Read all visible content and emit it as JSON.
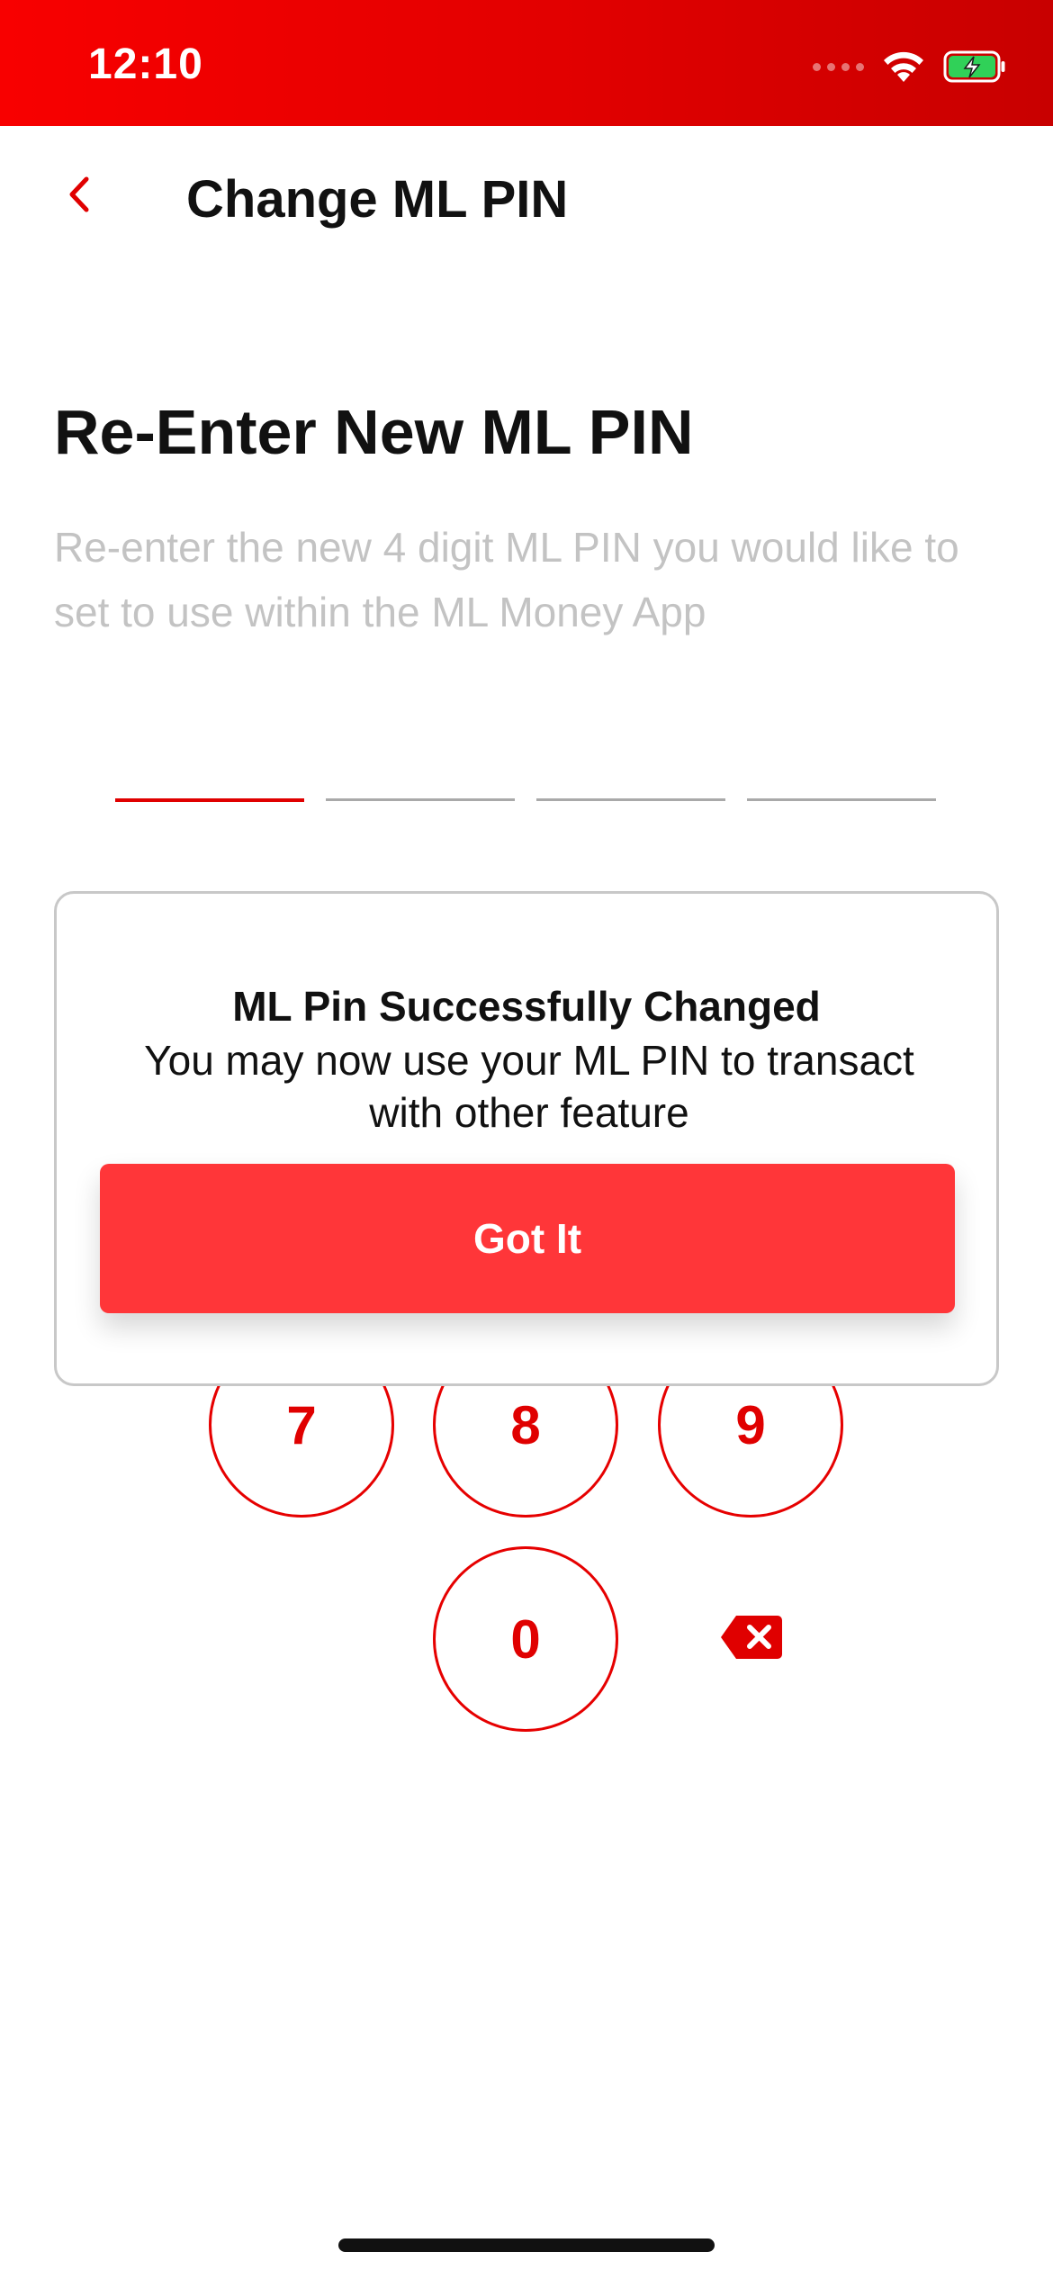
{
  "status_bar": {
    "time": "12:10",
    "icons": [
      "cellular-signal-icon",
      "wifi-icon",
      "battery-charging-icon"
    ],
    "background_color": "#e80000"
  },
  "header": {
    "back_icon": "chevron-left-icon",
    "title": "Change ML PIN"
  },
  "content": {
    "heading": "Re-Enter New ML PIN",
    "subtitle": "Re-enter the new 4 digit ML PIN you would like to set to use within the ML Money App",
    "pin_length": 4,
    "pin_active_index": 0
  },
  "keypad": {
    "keys": [
      "7",
      "8",
      "9",
      "0"
    ],
    "delete_icon": "backspace-icon"
  },
  "dialog": {
    "title": "ML Pin Successfully Changed",
    "message": "You may now use your ML PIN to transact with other feature",
    "button_label": "Got It"
  },
  "colors": {
    "accent": "#e00000",
    "button": "#ff3639",
    "subtitle_text": "#c3c3c3",
    "pin_inactive": "#a9a9a9"
  }
}
